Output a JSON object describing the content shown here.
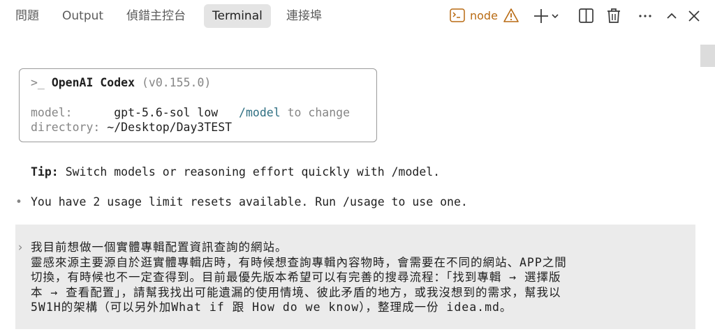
{
  "tabs": [
    {
      "label": "問題"
    },
    {
      "label": "Output"
    },
    {
      "label": "偵錯主控台"
    },
    {
      "label": "Terminal",
      "active": true
    },
    {
      "label": "連接埠"
    }
  ],
  "toolbar": {
    "terminal_name": "node",
    "icons": [
      "terminal-icon",
      "warning-icon",
      "plus-icon",
      "chevron-down-icon",
      "split-icon",
      "trash-icon",
      "more-icon",
      "chevron-up-icon",
      "close-icon"
    ]
  },
  "colors": {
    "accent_orange": "#b86a12",
    "active_tab_bg": "#e4e4e4",
    "prompt_bg": "#ebebeb",
    "teal": "#2f6f82"
  },
  "terminal": {
    "header_prompt": ">_",
    "app_name": "OpenAI Codex",
    "version": "(v0.155.0)",
    "model_label": "model:",
    "model_value": "gpt-5.6-sol low",
    "model_cmd": "/model",
    "model_hint": "to change",
    "dir_label": "directory:",
    "dir_value": "~/Desktop/Day3TEST",
    "tip_label": "Tip:",
    "tip_text": "Switch models or reasoning effort quickly with /model.",
    "bullet": "•",
    "usage_text": "You have 2 usage limit resets available. Run /usage to use one.",
    "prompt_marker": "›",
    "prompt_lines": [
      "我目前想做一個實體專輯配置資訊查詢的網站。",
      "靈感來源主要源自於逛實體專輯店時，有時候想查詢專輯內容物時，會需要在不同的網站、APP之間",
      "切換，有時候也不一定查得到。目前最優先版本希望可以有完善的搜尋流程：「找到專輯 → 選擇版",
      "本 → 查看配置」，請幫我找出可能遺漏的使用情境、彼此矛盾的地方，或我沒想到的需求，幫我以",
      "5W1H的架構（可以另外加What if 跟 How do we know），整理成一份 idea.md。"
    ]
  }
}
